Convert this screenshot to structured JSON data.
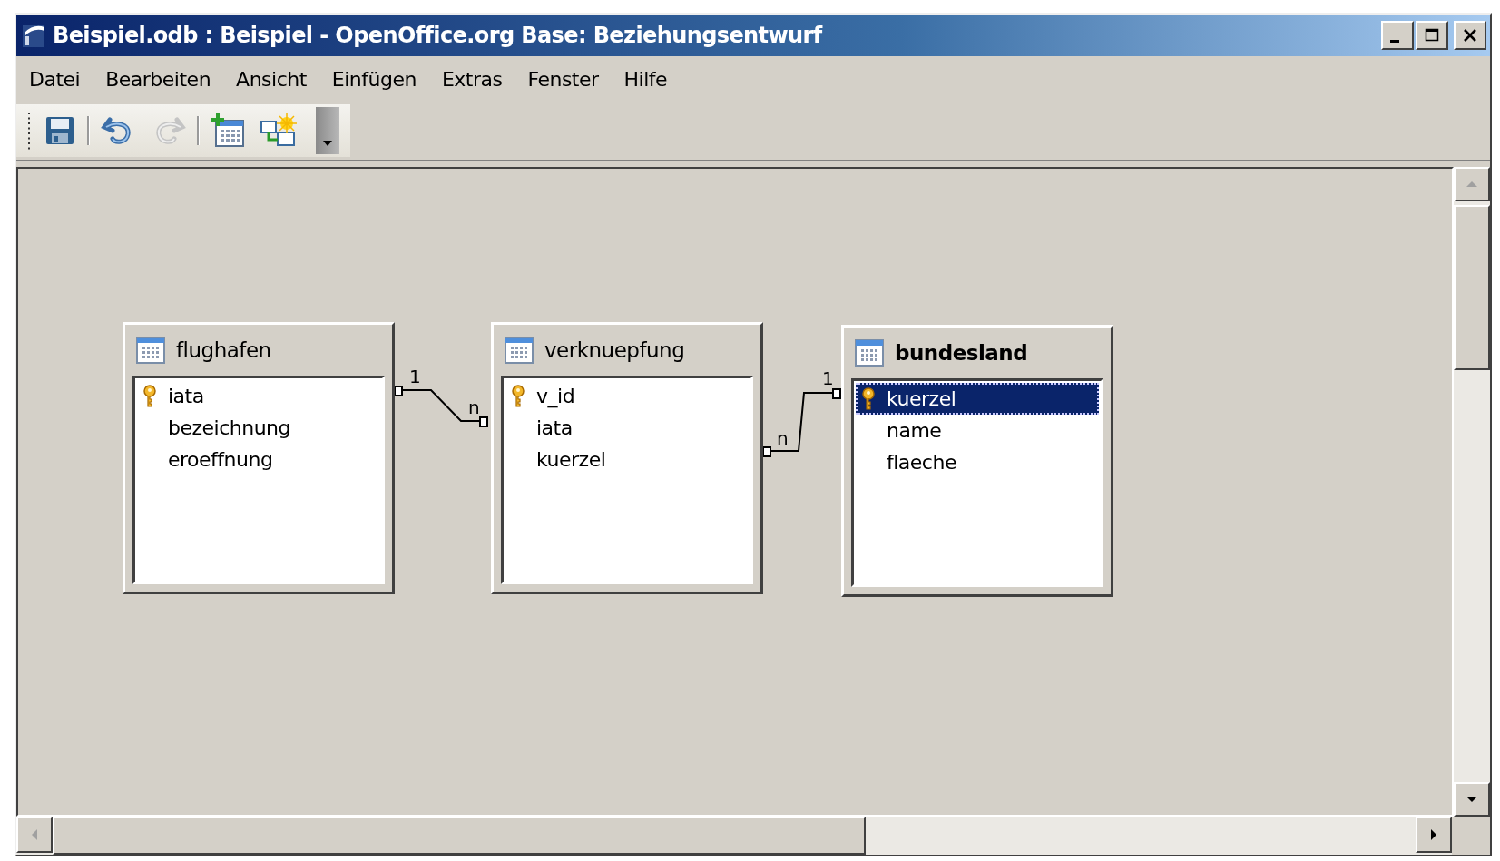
{
  "window": {
    "title": "Beispiel.odb : Beispiel - OpenOffice.org Base: Beziehungsentwurf"
  },
  "menu": [
    "Datei",
    "Bearbeiten",
    "Ansicht",
    "Einfügen",
    "Extras",
    "Fenster",
    "Hilfe"
  ],
  "toolbar": [
    {
      "kind": "save",
      "disabled": false
    },
    {
      "kind": "separator"
    },
    {
      "kind": "undo",
      "disabled": false
    },
    {
      "kind": "redo",
      "disabled": true
    },
    {
      "kind": "separator"
    },
    {
      "kind": "add-table",
      "disabled": false
    },
    {
      "kind": "new-relation",
      "disabled": false
    },
    {
      "kind": "overflow",
      "disabled": false
    }
  ],
  "tables": [
    {
      "name": "flughafen",
      "active": false,
      "fields": [
        {
          "name": "iata",
          "primary_key": true,
          "selected": false
        },
        {
          "name": "bezeichnung",
          "primary_key": false,
          "selected": false
        },
        {
          "name": "eroeffnung",
          "primary_key": false,
          "selected": false
        }
      ]
    },
    {
      "name": "verknuepfung",
      "active": false,
      "fields": [
        {
          "name": "v_id",
          "primary_key": true,
          "selected": false
        },
        {
          "name": "iata",
          "primary_key": false,
          "selected": false
        },
        {
          "name": "kuerzel",
          "primary_key": false,
          "selected": false
        }
      ]
    },
    {
      "name": "bundesland",
      "active": true,
      "fields": [
        {
          "name": "kuerzel",
          "primary_key": true,
          "selected": true
        },
        {
          "name": "name",
          "primary_key": false,
          "selected": false
        },
        {
          "name": "flaeche",
          "primary_key": false,
          "selected": false
        }
      ]
    }
  ],
  "relations": [
    {
      "from_cardinality": "1",
      "to_cardinality": "n"
    },
    {
      "from_cardinality": "n",
      "to_cardinality": "1"
    }
  ]
}
